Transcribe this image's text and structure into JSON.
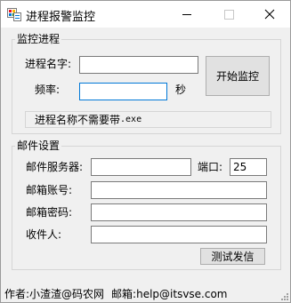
{
  "window": {
    "title": "进程报警监控"
  },
  "monitor_group": {
    "legend": "监控进程",
    "process_name_label": "进程名字:",
    "process_name_value": "",
    "frequency_label": "频率:",
    "frequency_value": "",
    "frequency_unit": "秒",
    "start_button_label": "开始监控",
    "hint_text": "进程名称不需要带",
    "hint_ext": ".exe"
  },
  "mail_group": {
    "legend": "邮件设置",
    "server_label": "邮件服务器:",
    "server_value": "",
    "port_label": "端口:",
    "port_value": "25",
    "account_label": "邮箱账号:",
    "account_value": "",
    "password_label": "邮箱密码:",
    "password_value": "",
    "recipient_label": "收件人:",
    "recipient_value": "",
    "test_button_label": "测试发信"
  },
  "status_bar": {
    "author": "作者:小渣渣@码农网",
    "email": "邮箱:help@itsvse.com"
  },
  "colors": {
    "focus_border": "#0078d7",
    "window_bg": "#f0f0f0",
    "button_bg": "#e1e1e1"
  }
}
